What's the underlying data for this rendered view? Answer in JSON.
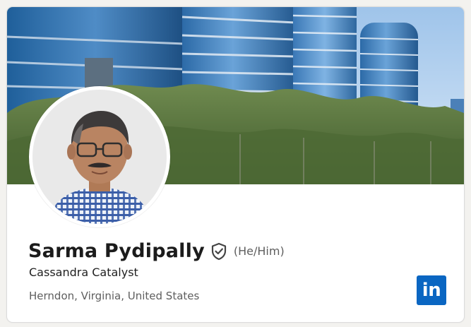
{
  "profile": {
    "name": "Sarma Pydipally",
    "pronouns": "(He/Him)",
    "headline": "Cassandra Catalyst",
    "location": "Herndon, Virginia, United States"
  },
  "badge": {
    "logo_text": "in",
    "icon": "linkedin-logo"
  },
  "icons": {
    "verified": "shield-check-icon"
  },
  "colors": {
    "brand": "#0a66c2",
    "name_text": "#1b1b1b",
    "secondary_text": "#5e5e5e",
    "card_bg": "#ffffff",
    "page_bg": "#f3f2ef"
  }
}
